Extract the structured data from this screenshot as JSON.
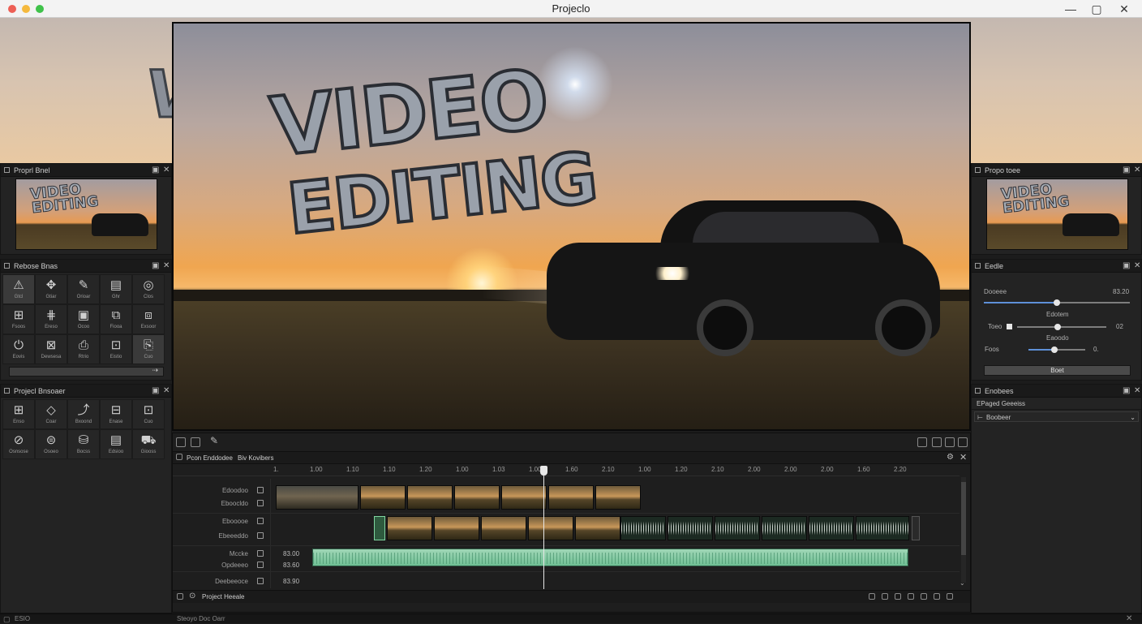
{
  "window": {
    "title": "Projeclo"
  },
  "hero_text": {
    "line1": "VIDEO",
    "line2": "EDITING"
  },
  "left_panels": {
    "preview_title": "Proprl Bnel",
    "thumb_line1": "VIDEO",
    "thumb_line2": "EDITING",
    "tools_title": "Rebose Bnas",
    "tools": [
      {
        "icon": "⚠",
        "label": "Gtcl"
      },
      {
        "icon": "✥",
        "label": "Gtiar"
      },
      {
        "icon": "✎",
        "label": "Orioar"
      },
      {
        "icon": "▤",
        "label": "Ghr"
      },
      {
        "icon": "◎",
        "label": "Clos"
      },
      {
        "icon": "⊞",
        "label": "Fsoos"
      },
      {
        "icon": "⋕",
        "label": "Ereso"
      },
      {
        "icon": "▣",
        "label": "Ocoo"
      },
      {
        "icon": "⧉",
        "label": "Fiooa"
      },
      {
        "icon": "⧈",
        "label": "Exsoor"
      },
      {
        "icon": "⏻",
        "label": "Eovis"
      },
      {
        "icon": "⊠",
        "label": "Dewsesa"
      },
      {
        "icon": "⎙",
        "label": "Rtrio"
      },
      {
        "icon": "⊡",
        "label": "Eistio"
      },
      {
        "icon": "⎘",
        "label": "Cuo"
      }
    ],
    "project_title": "Projecl Bnsoaer",
    "project_items": [
      {
        "icon": "⊞",
        "label": "Enso"
      },
      {
        "icon": "◇",
        "label": "Coar"
      },
      {
        "icon": "⤴",
        "label": "Bxoond"
      },
      {
        "icon": "⊟",
        "label": "Enase"
      },
      {
        "icon": "⊡",
        "label": "Cuo"
      },
      {
        "icon": "⊘",
        "label": "Osnsose"
      },
      {
        "icon": "⊜",
        "label": "Osoeo"
      },
      {
        "icon": "⛁",
        "label": "Bocss"
      },
      {
        "icon": "▤",
        "label": "Edsioo"
      },
      {
        "icon": "⛟",
        "label": "Giooss"
      }
    ]
  },
  "timeline": {
    "title": "Pcon Enddodee",
    "subtitle": "Biv Kovibers",
    "ruler": [
      "1.",
      "1.00",
      "1.10",
      "1.10",
      "1.20",
      "1.00",
      "1.03",
      "1.00",
      "1.60",
      "2.10",
      "1.00",
      "1.20",
      "2.10",
      "2.00",
      "2.00",
      "2.00",
      "1.60",
      "2.20"
    ],
    "tracks": [
      {
        "label": "Edoodoo"
      },
      {
        "label": "Eboocldo"
      },
      {
        "label": "Ebooooe"
      },
      {
        "label": "Ebeeeddo"
      },
      {
        "label": "Mccke"
      },
      {
        "label": "Opdeeeo"
      },
      {
        "label": "Deebeeoce"
      }
    ],
    "times": [
      "83.00",
      "83.60",
      "83.90"
    ],
    "footer": "Project Heeale"
  },
  "right_panels": {
    "preview_title": "Propo toee",
    "thumb_line1": "VIDEO",
    "thumb_line2": "EDITING",
    "effects_title": "Eedle",
    "slider1_label": "Dooeee",
    "slider1_value": "83.20",
    "slider1_level": 0.5,
    "slider2_label": "Edotem",
    "slider2_row_label": "Toeo",
    "slider2_value": "02",
    "slider2_level": 0.45,
    "slider3_label": "Eaoodo",
    "slider3_row_label": "Foos",
    "slider3_value": "0.",
    "slider3_level": 0.45,
    "apply_label": "Boet",
    "browser_title": "Enobees",
    "browser_item1": "EPaged Geeeiss",
    "browser_item2": "Boobeer"
  },
  "status": {
    "left": "ESIO",
    "center": "Steoyo Doc Oarr"
  }
}
